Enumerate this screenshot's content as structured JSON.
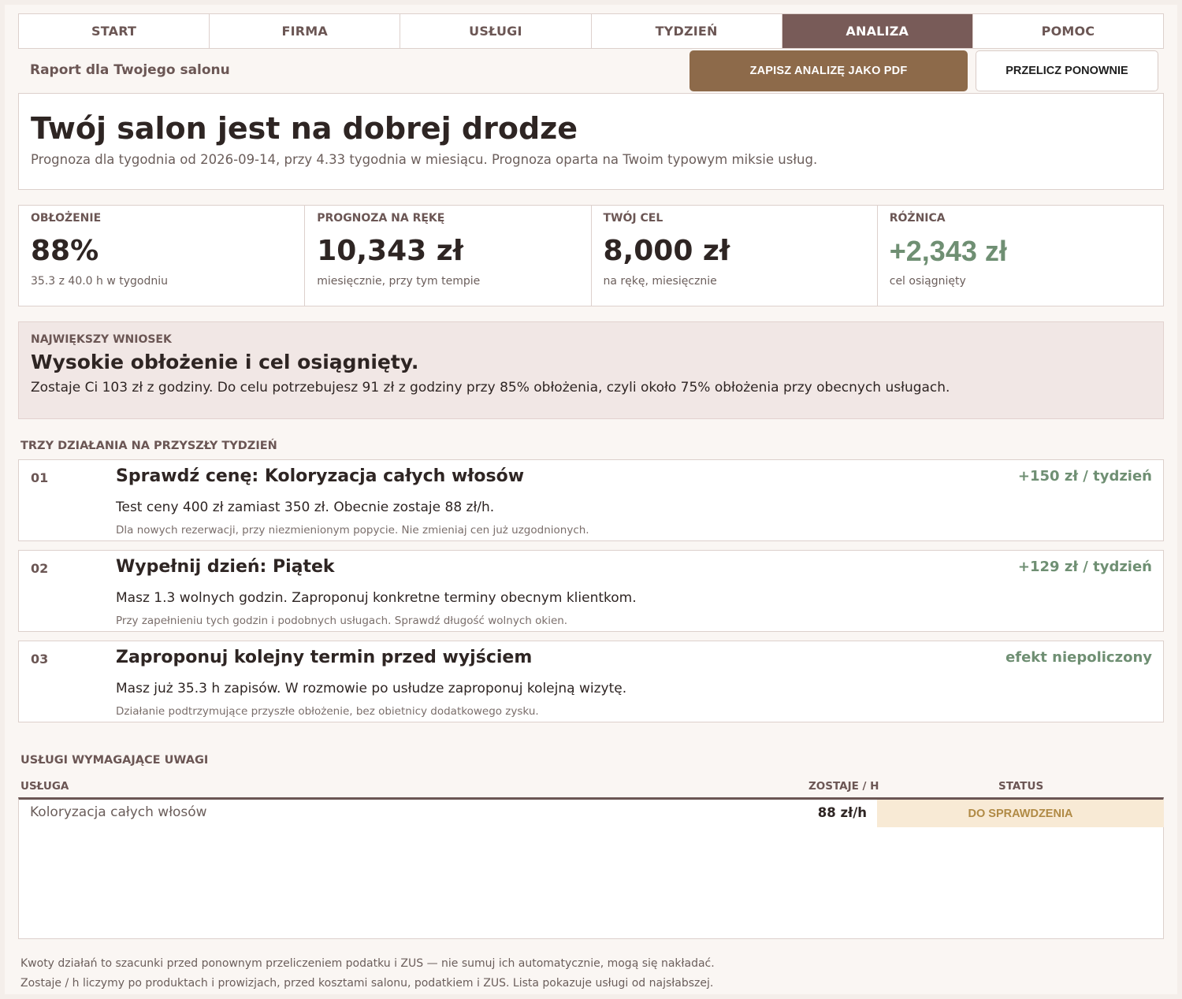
{
  "tabs": [
    "START",
    "FIRMA",
    "USŁUGI",
    "TYDZIEŃ",
    "ANALIZA",
    "POMOC"
  ],
  "active_tab": "ANALIZA",
  "header": {
    "subtitle": "Raport dla Twojego salonu",
    "pdf_button": "ZAPISZ ANALIZĘ JAKO PDF",
    "recalc_button": "PRZELICZ PONOWNIE"
  },
  "hero": {
    "title": "Twój salon jest na dobrej drodze",
    "text": "Prognoza dla tygodnia od 2026-09-14, przy 4.33 tygodnia w miesiącu. Prognoza oparta na Twoim typowym miksie usług."
  },
  "kpis": [
    {
      "label": "OBŁOŻENIE",
      "value": "88%",
      "note": "35.3 z 40.0 h w tygodniu"
    },
    {
      "label": "PROGNOZA NA RĘKĘ",
      "value": "10,343 zł",
      "note": "miesięcznie, przy tym tempie"
    },
    {
      "label": "TWÓJ CEL",
      "value": "8,000 zł",
      "note": "na rękę, miesięcznie"
    },
    {
      "label": "RÓŻNICA",
      "value": "+2,343 zł",
      "note": "cel osiągnięty"
    }
  ],
  "insight": {
    "label": "NAJWIĘKSZY WNIOSEK",
    "title": "Wysokie obłożenie i cel osiągnięty.",
    "text": "Zostaje Ci 103 zł z godziny. Do celu potrzebujesz 91 zł z godziny przy 85% obłożenia, czyli około 75% obłożenia przy obecnych usługach."
  },
  "actions_title": "TRZY DZIAŁANIA NA PRZYSZŁY TYDZIEŃ",
  "actions": [
    {
      "num": "01",
      "title": "Sprawdź cenę: Koloryzacja całych włosów",
      "impact": "+150 zł / tydzień",
      "desc": "Test ceny 400 zł zamiast 350 zł. Obecnie zostaje 88 zł/h.",
      "note": "Dla nowych rezerwacji, przy niezmienionym popycie. Nie zmieniaj cen już uzgodnionych."
    },
    {
      "num": "02",
      "title": "Wypełnij dzień: Piątek",
      "impact": "+129 zł / tydzień",
      "desc": "Masz 1.3 wolnych godzin. Zaproponuj konkretne terminy obecnym klientkom.",
      "note": "Przy zapełnieniu tych godzin i podobnych usługach. Sprawdź długość wolnych okien."
    },
    {
      "num": "03",
      "title": "Zaproponuj kolejny termin przed wyjściem",
      "impact": "efekt niepoliczony",
      "desc": "Masz już 35.3 h zapisów. W rozmowie po usłudze zaproponuj kolejną wizytę.",
      "note": "Działanie podtrzymujące przyszłe obłożenie, bez obietnicy dodatkowego zysku."
    }
  ],
  "services": {
    "title": "USŁUGI WYMAGAJĄCE UWAGI",
    "columns": [
      "USŁUGA",
      "ZOSTAJE / H",
      "STATUS"
    ],
    "rows": [
      {
        "name": "Koloryzacja całych włosów",
        "per_hour": "88 zł/h",
        "status": "DO SPRAWDZENIA"
      }
    ]
  },
  "footer": [
    "Kwoty działań to szacunki przed ponownym przeliczeniem podatku i ZUS — nie sumuj ich automatycznie, mogą się nakładać.",
    "Zostaje / h liczymy po produktach i prowizjach, przed kosztami salonu, podatkiem i ZUS. Lista pokazuje usługi od najsłabszej."
  ],
  "colors": {
    "accent": "#785b58",
    "pdf_button": "#8d6a4a",
    "positive": "#6f8f73",
    "status_bg": "#f8ead5",
    "status_text": "#b08a45"
  }
}
